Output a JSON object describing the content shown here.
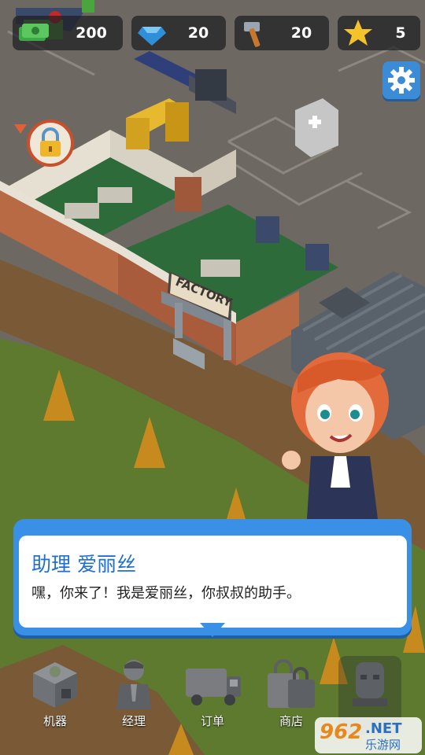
{
  "resources": {
    "cash": {
      "value": "200",
      "icon": "cash-icon"
    },
    "gems": {
      "value": "20",
      "icon": "gem-icon"
    },
    "hammers": {
      "value": "20",
      "icon": "hammer-icon"
    },
    "stars": {
      "value": "5",
      "icon": "star-icon"
    }
  },
  "building": {
    "sign": "FACTORY"
  },
  "dialog": {
    "name": "助理 爱丽丝",
    "text": "嘿，你来了！我是爱丽丝，你叔叔的助手。"
  },
  "menu": {
    "items": [
      {
        "label": "机器",
        "icon": "machine-icon"
      },
      {
        "label": "经理",
        "icon": "manager-icon"
      },
      {
        "label": "订单",
        "icon": "truck-icon"
      },
      {
        "label": "商店",
        "icon": "shop-bag-icon"
      },
      {
        "label": "",
        "icon": "statue-icon"
      }
    ]
  },
  "watermark": {
    "text1": "962",
    "text2": ".NET",
    "text3": "乐游网"
  },
  "colors": {
    "accent": "#3a8fe6",
    "cash": "#3fa64a",
    "gem": "#2f8fd8",
    "star": "#f4c22b"
  }
}
